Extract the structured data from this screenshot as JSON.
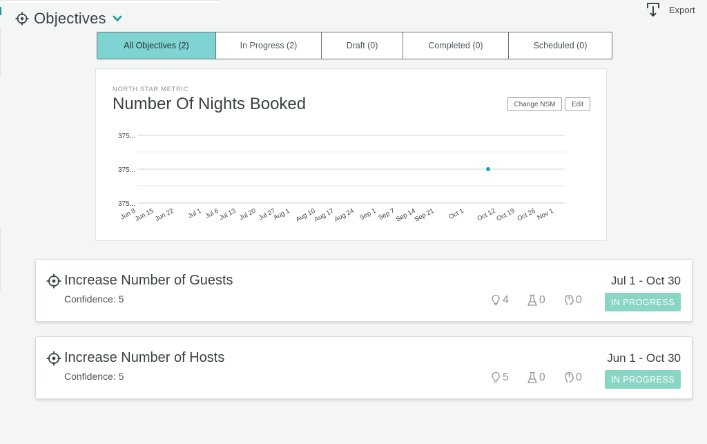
{
  "header": {
    "title": "Objectives"
  },
  "export": {
    "label": "Export"
  },
  "tabs": [
    {
      "label": "All Objectives (2)",
      "active": true
    },
    {
      "label": "In Progress (2)",
      "active": false
    },
    {
      "label": "Draft (0)",
      "active": false
    },
    {
      "label": "Completed (0)",
      "active": false
    },
    {
      "label": "Scheduled (0)",
      "active": false
    }
  ],
  "nsm": {
    "label": "NORTH STAR METRIC",
    "title": "Number Of Nights Booked",
    "change_button": "Change NSM",
    "edit_button": "Edit"
  },
  "chart_data": {
    "type": "line",
    "title": "Number Of Nights Booked",
    "xlabel": "",
    "ylabel": "",
    "y_tick_labels": [
      "375...",
      "375...",
      "375..."
    ],
    "x_tick_labels": [
      "Jun 8",
      "Jun 15",
      "Jun 22",
      "Jul 1",
      "Jul 6",
      "Jul 13",
      "Jul 20",
      "Jul 27",
      "Aug 1",
      "Aug 10",
      "Aug 17",
      "Aug 24",
      "Sep 1",
      "Sep 7",
      "Sep 14",
      "Sep 21",
      "Oct 1",
      "Oct 12",
      "Oct 19",
      "Oct 26",
      "Nov 1"
    ],
    "series": [
      {
        "points": [
          {
            "x": "Oct 5",
            "y": 375
          }
        ],
        "color": "#1aa3c4"
      }
    ],
    "grid": true,
    "legend": "none"
  },
  "objectives": [
    {
      "title": "Increase Number of Guests",
      "confidence": "Confidence: 5",
      "dates": "Jul 1 - Oct 30",
      "ideas": "4",
      "experiments": "0",
      "learnings": "0",
      "status": "IN PROGRESS"
    },
    {
      "title": "Increase Number of Hosts",
      "confidence": "Confidence: 5",
      "dates": "Jun 1 - Oct 30",
      "ideas": "5",
      "experiments": "0",
      "learnings": "0",
      "status": "IN PROGRESS"
    }
  ],
  "colors": {
    "accent": "#1a9a8c",
    "tab_active": "#7fd3d2",
    "status_badge": "#8ad6c4",
    "chart_point": "#1aa3c4"
  },
  "icons": {
    "objective": "crosshair-target-icon",
    "dropdown": "chevron-down-icon",
    "export": "download-tray-icon",
    "ideas": "lightbulb-icon",
    "experiments": "flask-icon",
    "learnings": "head-icon"
  }
}
